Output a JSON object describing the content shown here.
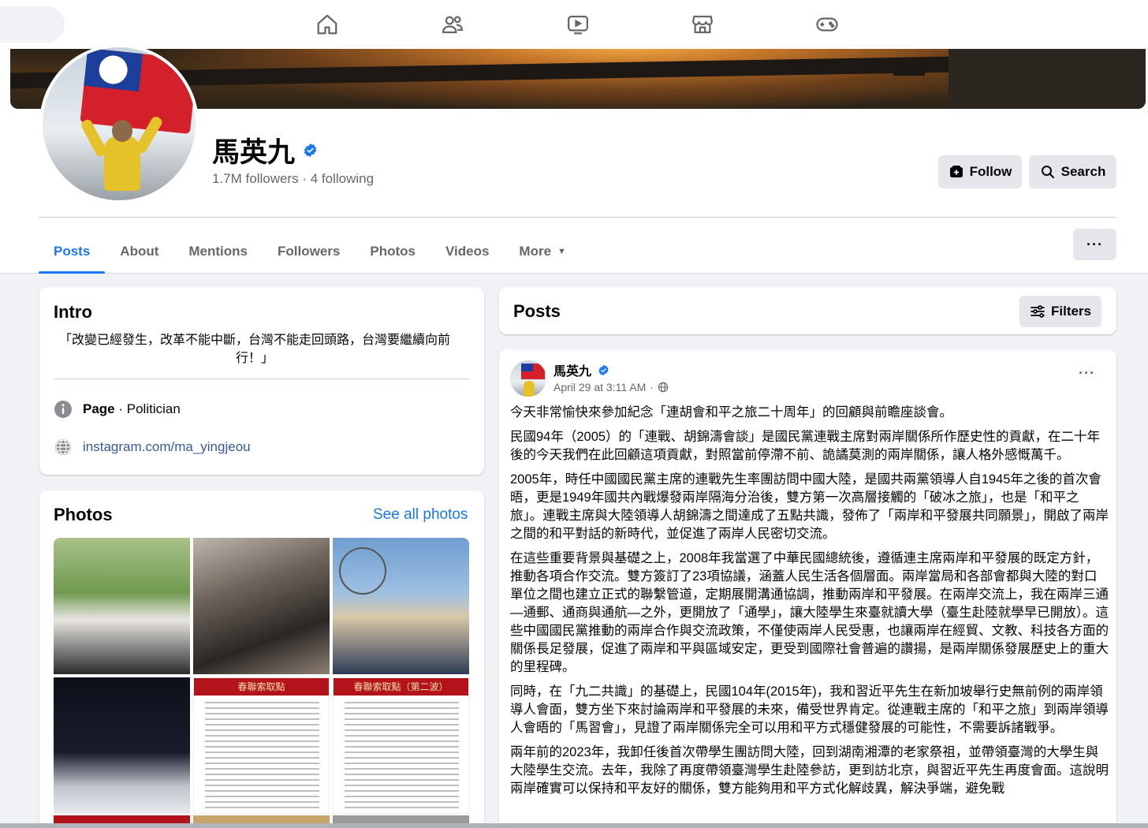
{
  "profile": {
    "name": "馬英九",
    "followers": "1.7M followers",
    "separator": "·",
    "following": "4 following",
    "follow_label": "Follow",
    "search_label": "Search"
  },
  "tabs": {
    "posts": "Posts",
    "about": "About",
    "mentions": "Mentions",
    "followers": "Followers",
    "photos": "Photos",
    "videos": "Videos",
    "more": "More",
    "more_menu": "···"
  },
  "intro": {
    "title": "Intro",
    "bio": "「改變已經發生，改革不能中斷，台灣不能走回頭路，台灣要繼續向前行！」",
    "page_label": "Page",
    "page_type": " · Politician",
    "link": "instagram.com/ma_yingjeou"
  },
  "photos": {
    "title": "Photos",
    "see_all": "See all photos",
    "tile5_banner": "春聯索取點",
    "tile6_banner": "春聯索取點（第二波）"
  },
  "posts_section": {
    "title": "Posts",
    "filters_label": "Filters"
  },
  "post": {
    "author": "馬英九",
    "timestamp": "April 29 at 3:11 AM",
    "meta_sep": "·",
    "more": "···",
    "paragraphs": [
      "今天非常愉快來參加紀念「連胡會和平之旅二十周年」的回顧與前瞻座談會。",
      "民國94年（2005）的「連戰、胡錦濤會談」是國民黨連戰主席對兩岸關係所作歷史性的貢獻，在二十年後的今天我們在此回顧這項貢獻，對照當前停滯不前、詭譎莫測的兩岸關係，讓人格外感慨萬千。",
      "2005年，時任中國國民黨主席的連戰先生率團訪問中國大陸，是國共兩黨領導人自1945年之後的首次會晤，更是1949年國共內戰爆發兩岸隔海分治後，雙方第一次高層接觸的「破冰之旅」，也是「和平之旅」。連戰主席與大陸領導人胡錦濤之間達成了五點共識，發佈了「兩岸和平發展共同願景」，開啟了兩岸之間的和平對話的新時代，並促進了兩岸人民密切交流。",
      "在這些重要背景與基礎之上，2008年我當選了中華民國總統後，遵循連主席兩岸和平發展的既定方針，推動各項合作交流。雙方簽訂了23項協議，涵蓋人民生活各個層面。兩岸當局和各部會都與大陸的對口單位之間也建立正式的聯繫管道，定期展開溝通協調，推動兩岸和平發展。在兩岸交流上，我在兩岸三通—通郵、通商與通航—之外，更開放了「通學」，讓大陸學生來臺就讀大學（臺生赴陸就學早已開放）。這些中國國民黨推動的兩岸合作與交流政策，不僅使兩岸人民受惠，也讓兩岸在經貿、文教、科技各方面的關係長足發展，促進了兩岸和平與區域安定，更受到國際社會普遍的讚揚，是兩岸關係發展歷史上的重大的里程碑。",
      "同時，在「九二共識」的基礎上，民國104年(2015年)，我和習近平先生在新加坡舉行史無前例的兩岸領導人會面，雙方坐下來討論兩岸和平發展的未來，備受世界肯定。從連戰主席的「和平之旅」到兩岸領導人會晤的「馬習會」，見證了兩岸關係完全可以用和平方式穩健發展的可能性，不需要訴諸戰爭。",
      "兩年前的2023年，我卸任後首次帶學生團訪問大陸，回到湖南湘潭的老家祭祖，並帶領臺灣的大學生與大陸學生交流。去年，我除了再度帶領臺灣學生赴陸參訪，更到訪北京，與習近平先生再度會面。這說明兩岸確實可以保持和平友好的關係，雙方能夠用和平方式化解歧異，解決爭端，避免戰"
    ]
  },
  "colors": {
    "accent": "#1877f2",
    "verified": "#1877f2",
    "background": "#f0f2f5",
    "card": "#ffffff",
    "secondary_text": "#65676b",
    "button_bg": "#e4e6eb"
  },
  "icons": [
    "home-icon",
    "friends-icon",
    "video-icon",
    "marketplace-icon",
    "gaming-icon",
    "verified-badge-icon",
    "follow-icon",
    "search-icon",
    "info-icon",
    "globe-icon",
    "filters-icon",
    "privacy-globe-icon",
    "more-dots-icon"
  ]
}
